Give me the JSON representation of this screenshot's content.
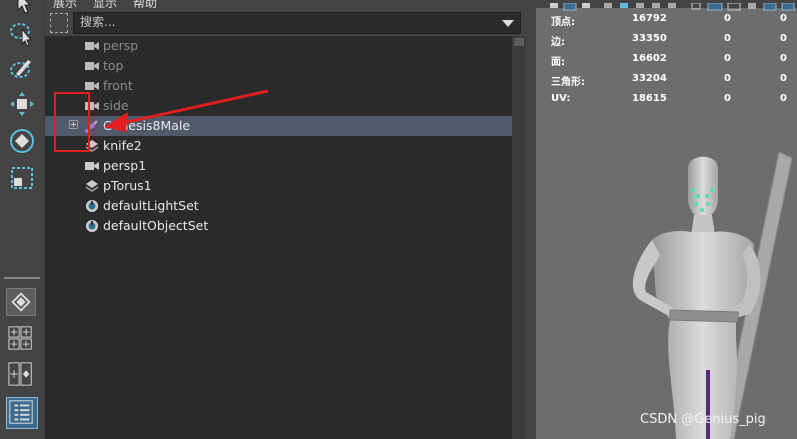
{
  "menu": {
    "items": [
      "展示",
      "显示",
      "帮助"
    ]
  },
  "search": {
    "placeholder": "搜索..."
  },
  "outliner": {
    "items": [
      {
        "label": "persp",
        "icon": "camera-icon",
        "dim": true
      },
      {
        "label": "top",
        "icon": "camera-icon",
        "dim": true
      },
      {
        "label": "front",
        "icon": "camera-icon",
        "dim": true
      },
      {
        "label": "side",
        "icon": "camera-icon",
        "dim": true
      },
      {
        "label": "Genesis8Male",
        "icon": "joint-icon",
        "selected": true,
        "expandable": true
      },
      {
        "label": "knife2",
        "icon": "mesh-icon"
      },
      {
        "label": "persp1",
        "icon": "camera-icon"
      },
      {
        "label": "pTorus1",
        "icon": "mesh-icon"
      },
      {
        "label": "defaultLightSet",
        "icon": "set-icon"
      },
      {
        "label": "defaultObjectSet",
        "icon": "set-icon"
      }
    ]
  },
  "stats": {
    "rows": [
      {
        "label": "顶点:",
        "v1": "16792",
        "v2": "0",
        "v3": "0"
      },
      {
        "label": "边:",
        "v1": "33350",
        "v2": "0",
        "v3": "0"
      },
      {
        "label": "面:",
        "v1": "16602",
        "v2": "0",
        "v3": "0"
      },
      {
        "label": "三角形:",
        "v1": "33204",
        "v2": "0",
        "v3": "0"
      },
      {
        "label": "UV:",
        "v1": "18615",
        "v2": "0",
        "v3": "0"
      }
    ]
  },
  "watermark": "CSDN @Genius_pig",
  "colors": {
    "annotation": "#e02020",
    "selection": "#52596a",
    "accent": "#5bc0de"
  }
}
